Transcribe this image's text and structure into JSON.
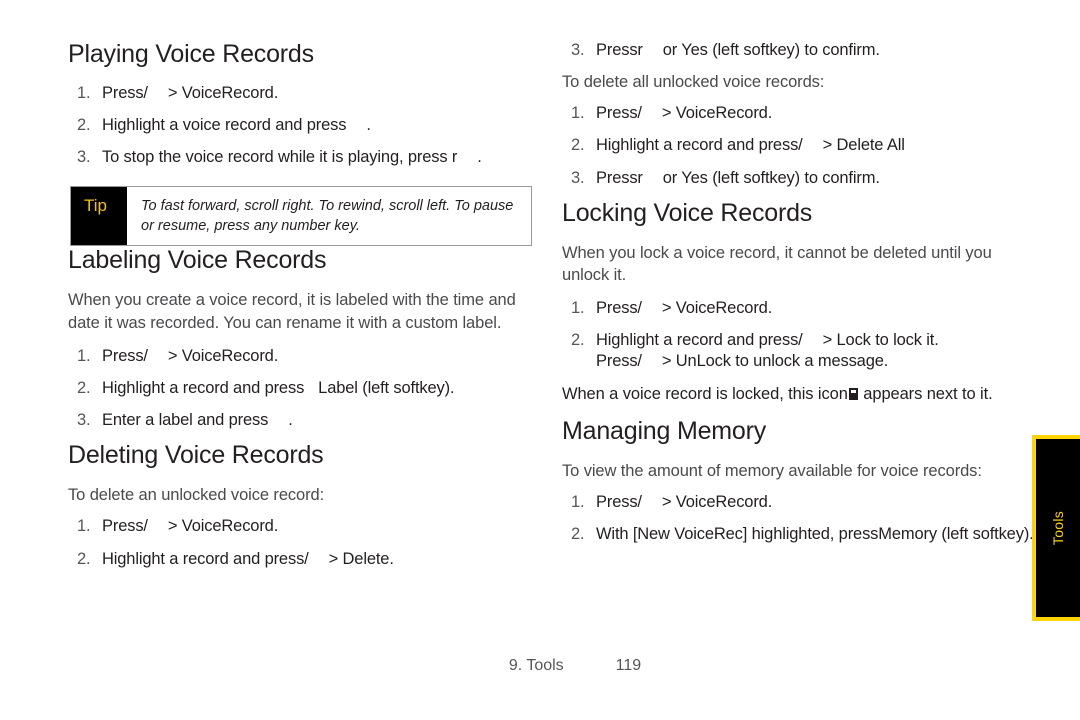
{
  "document": {
    "footer": {
      "chapter": "9. Tools",
      "page_number": "119"
    },
    "side_tab": {
      "label": "Tools",
      "background_color": "#000000",
      "border_color": "#ffd400",
      "text_color": "#ffd400"
    }
  },
  "left_column": {
    "sections": [
      {
        "heading": "Playing Voice Records",
        "steps": [
          {
            "prefix": "Press/",
            "suffix": "> VoiceRecord."
          },
          {
            "prefix": "Highlight a voice record and press",
            "suffix": "."
          },
          {
            "prefix": "To stop the voice record while it is playing, press r",
            "suffix": "."
          }
        ]
      },
      {
        "heading": "Labeling Voice Records",
        "intro": "When you create a voice record, it is labeled with the time and date it was recorded. You can rename it with a custom label.",
        "steps": [
          {
            "prefix": "Press/",
            "suffix": "> VoiceRecord."
          },
          {
            "prefix": "Highlight a record and press",
            "suffix": "Label (left softkey)."
          },
          {
            "prefix": "Enter a label and press",
            "suffix": "."
          }
        ]
      },
      {
        "heading": "Deleting Voice Records",
        "intro": "To delete an unlocked voice record:",
        "steps": [
          {
            "prefix": "Press/",
            "suffix": "> VoiceRecord."
          },
          {
            "prefix": "Highlight a record and press/",
            "suffix": "> Delete."
          }
        ]
      }
    ],
    "tip": {
      "label": "Tip",
      "text": "To fast forward, scroll right. To rewind, scroll left. To pause or resume, press any number key."
    }
  },
  "right_column": {
    "continued_step": {
      "number": "3.",
      "prefix": "Pressr",
      "suffix": "or Yes (left softkey) to confirm."
    },
    "delete_all": {
      "intro": "To delete all unlocked voice records:",
      "steps": [
        {
          "prefix": "Press/",
          "suffix": "> VoiceRecord."
        },
        {
          "prefix": "Highlight a record and press/",
          "suffix": "> Delete All"
        },
        {
          "prefix": "Pressr",
          "suffix": "or Yes (left softkey) to confirm."
        }
      ]
    },
    "sections": [
      {
        "heading": "Locking Voice Records",
        "intro": "When you lock a voice record, it cannot be deleted until you unlock it.",
        "steps": [
          {
            "prefix": "Press/",
            "suffix": "> VoiceRecord."
          },
          {
            "prefix": "Highlight a record and press/",
            "suffix": "> Lock to lock it."
          },
          {
            "prefix": "Press/",
            "suffix": "> UnLock to unlock a message."
          }
        ],
        "outro_before_icon": "When a voice record is locked, this icon",
        "outro_after_icon": "appears next to it."
      },
      {
        "heading": "Managing Memory",
        "intro": "To view the amount of memory available for voice records:",
        "steps": [
          {
            "prefix": "Press/",
            "suffix": "> VoiceRecord."
          },
          {
            "prefix": "With [New VoiceRec] highlighted, press",
            "suffix": "Memory (left softkey)."
          }
        ]
      }
    ]
  }
}
